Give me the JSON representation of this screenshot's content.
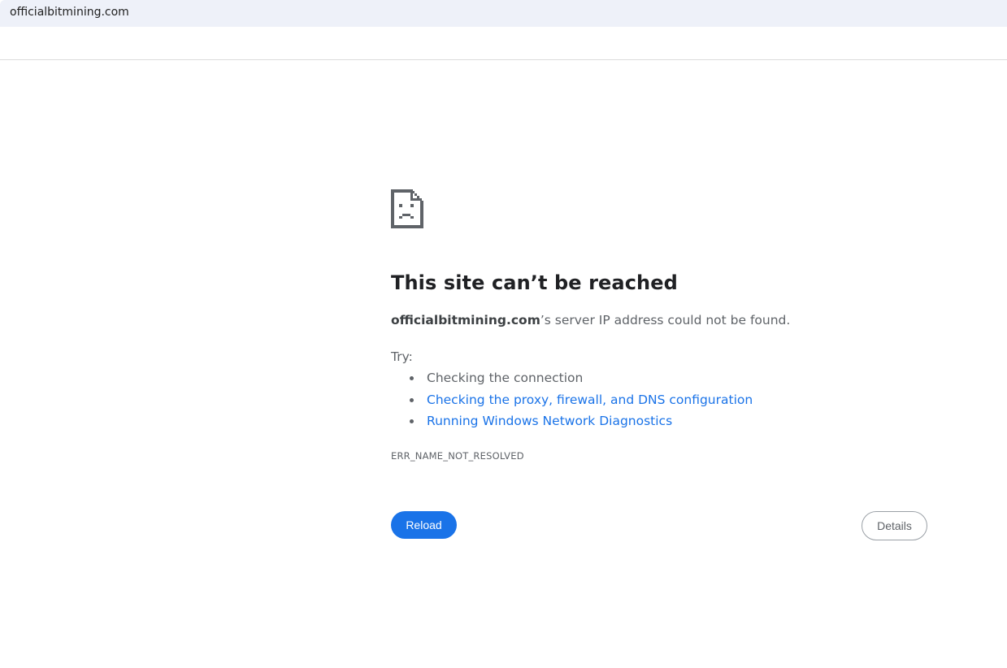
{
  "browser": {
    "address": "officialbitmining.com"
  },
  "error_page": {
    "icon": "sad-document-icon",
    "title": "This site can’t be reached",
    "description_host": "officialbitmining.com",
    "description_rest": "’s server IP address could not be found.",
    "try_label": "Try:",
    "suggestions": [
      {
        "label": "Checking the connection",
        "is_link": false
      },
      {
        "label": "Checking the proxy, firewall, and DNS configuration",
        "is_link": true
      },
      {
        "label": "Running Windows Network Diagnostics",
        "is_link": true
      }
    ],
    "error_code": "ERR_NAME_NOT_RESOLVED",
    "reload_label": "Reload",
    "details_label": "Details"
  },
  "colors": {
    "accent": "#1a73e8",
    "address_bar_bg": "#eef1f9",
    "text_secondary": "#5f6368"
  }
}
